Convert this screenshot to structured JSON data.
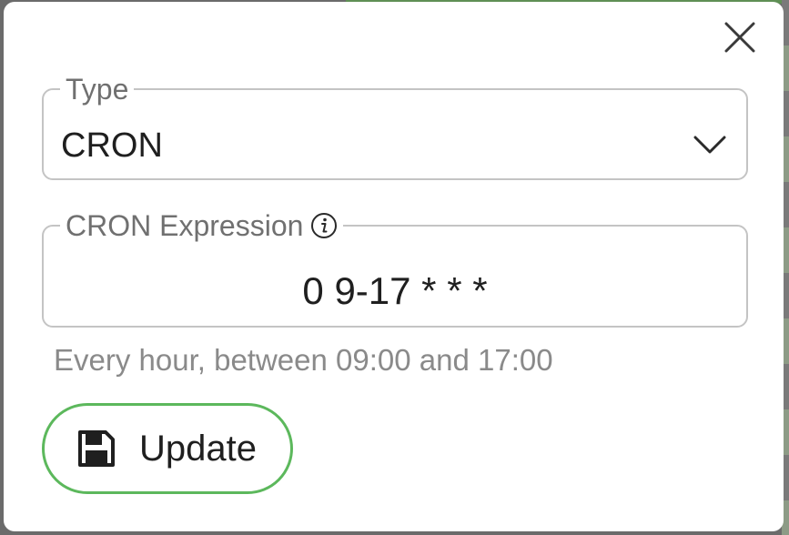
{
  "dialog": {
    "close_icon": "close-icon"
  },
  "type_field": {
    "label": "Type",
    "value": "CRON",
    "dropdown_icon": "chevron-down-icon"
  },
  "cron_field": {
    "label": "CRON Expression",
    "info_icon": "info-icon",
    "value": "0 9-17 * * *",
    "description": "Every hour, between 09:00 and 17:00"
  },
  "actions": {
    "update_label": "Update",
    "update_icon": "save-icon",
    "accent_color": "#5cb85c"
  }
}
